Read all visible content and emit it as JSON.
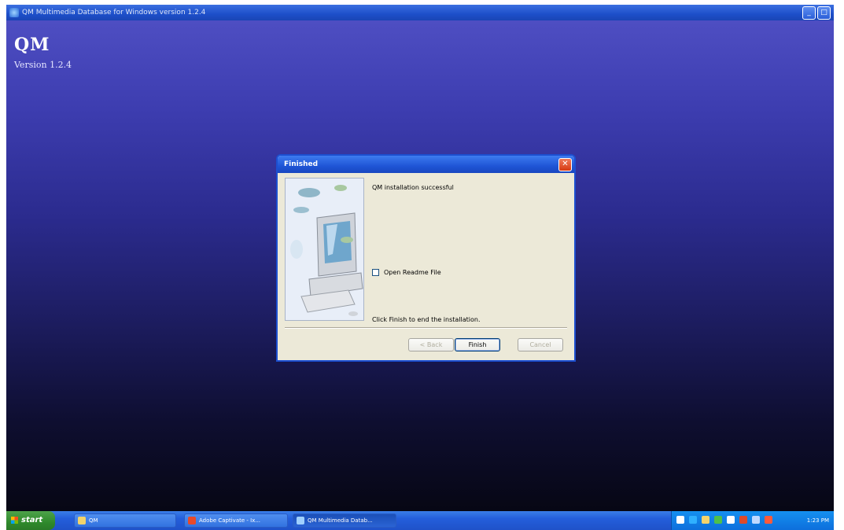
{
  "window": {
    "title": "QM Multimedia Database for Windows version 1.2.4",
    "controls": [
      "minimize",
      "maximize"
    ]
  },
  "brand": {
    "title": "QM",
    "version": "Version 1.2.4"
  },
  "dialog": {
    "title": "Finished",
    "message": "QM installation successful",
    "checkbox_label": "Open Readme File",
    "checkbox_checked": false,
    "footer_text": "Click Finish to end the installation.",
    "buttons": {
      "back": "< Back",
      "finish": "Finish",
      "cancel": "Cancel"
    }
  },
  "taskbar": {
    "start_label": "start",
    "items": [
      {
        "label": "QM",
        "icon": "folder-icon"
      },
      {
        "label": "Adobe Captivate - Ix...",
        "icon": "captivate-icon"
      },
      {
        "label": "QM Multimedia Datab...",
        "icon": "installer-icon"
      }
    ],
    "clock": "1:23 PM"
  },
  "colors": {
    "titlebar": "#1f55d6",
    "desktop_top": "#4e4ec2",
    "desktop_bottom": "#070714",
    "dialog_bg": "#ece9d8",
    "start_green": "#2f8a2c",
    "close_red": "#d63a12"
  }
}
